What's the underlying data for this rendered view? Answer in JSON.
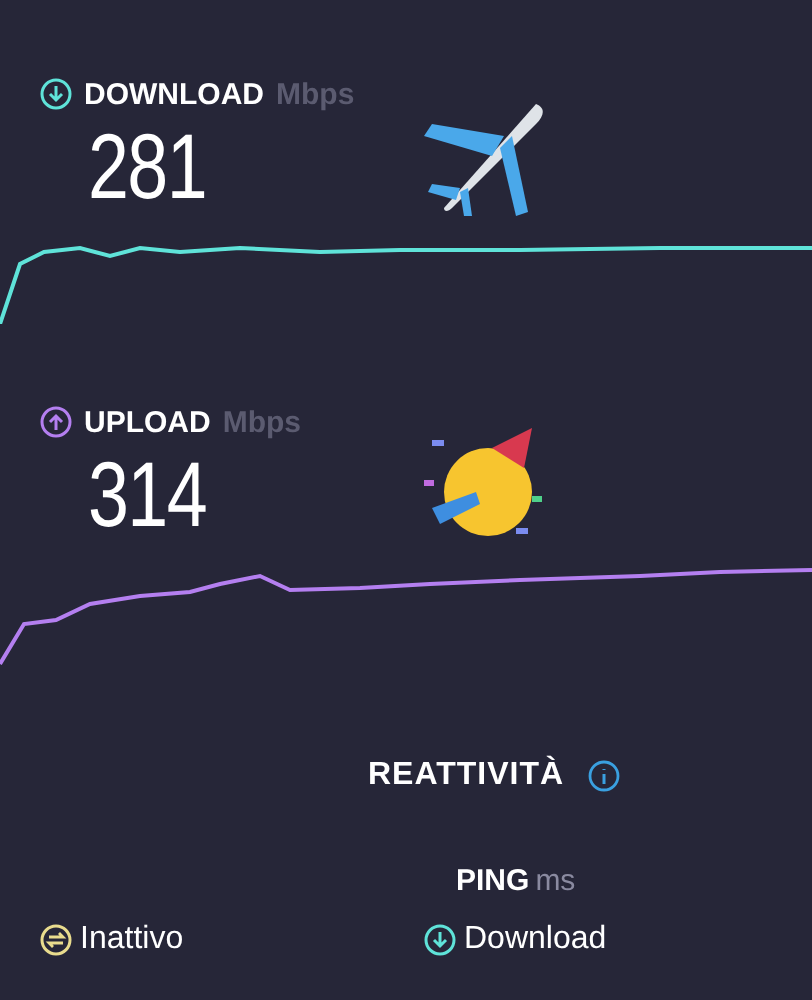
{
  "results": [
    {
      "kind": "download",
      "label": "DOWNLOAD",
      "unit": "Mbps",
      "value": "281"
    },
    {
      "kind": "upload",
      "label": "UPLOAD",
      "unit": "Mbps",
      "value": "314"
    }
  ],
  "responsiveness": {
    "title": "REATTIVITÀ",
    "ping_label": "PING",
    "ping_unit": "ms",
    "items": [
      {
        "kind": "idle",
        "label": "Inattivo"
      },
      {
        "kind": "download",
        "label": "Download"
      }
    ]
  }
}
